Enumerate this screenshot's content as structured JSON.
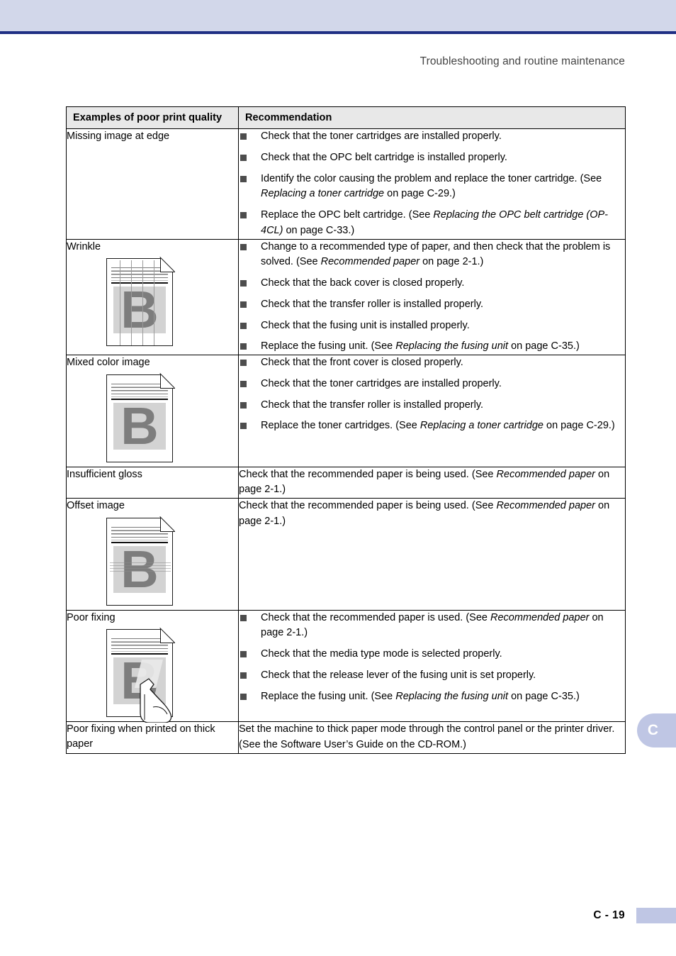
{
  "page": {
    "running_header": "Troubleshooting and routine maintenance",
    "folio": "C - 19",
    "thumb_tab": "C",
    "colors": {
      "band": "#d2d7ea",
      "rule": "#1f2f84",
      "tab": "#bfc6e4",
      "header_row": "#e8e8e8",
      "bullet": "#4d4d4d"
    }
  },
  "table": {
    "headers": {
      "col_a": "Examples of poor print quality",
      "col_b": "Recommendation"
    },
    "rows": [
      {
        "label": "Missing image at edge",
        "illustration": "none",
        "list": [
          "Check that the toner cartridges are installed properly.",
          "Check that the OPC belt cartridge is installed properly.",
          "Identify the color causing the problem and replace the toner cartridge. (See Replacing a toner cartridge on page C-29.)",
          "Replace the OPC belt cartridge. (See Replacing the OPC belt cartridge (OP-4CL) on page C-33.)"
        ],
        "list_html": [
          "Check that the toner cartridges are installed properly.",
          "Check that the OPC belt cartridge is installed properly.",
          "Identify the color causing the problem and replace the toner cartridge. (See <em>Replacing a toner cartridge</em> on page C-29.)",
          "Replace the OPC belt cartridge. (See <em>Replacing the OPC belt cartridge (OP-4CL)</em> on page C-33.)"
        ]
      },
      {
        "label": "Wrinkle",
        "illustration": "wrinkled-page-sample",
        "list": [
          "Change to a recommended type of paper, and then check that the problem is solved. (See Recommended paper on page 2-1.)",
          "Check that the back cover is closed properly.",
          "Check that the transfer roller is installed properly.",
          "Check that the fusing unit is installed properly.",
          "Replace the fusing unit. (See Replacing the fusing unit on page C-35.)"
        ],
        "list_html": [
          "Change to a recommended type of paper, and then check that the problem is solved. (See <em>Recommended paper</em> on page 2-1.)",
          "Check that the back cover is closed properly.",
          "Check that the transfer roller is installed properly.",
          "Check that the fusing unit is installed properly.",
          "Replace the fusing unit. (See <em>Replacing the fusing unit</em> on page C-35.)"
        ]
      },
      {
        "label": "Mixed color image",
        "illustration": "mixed-color-page-sample",
        "list": [
          "Check that the front cover is closed properly.",
          "Check that the toner cartridges are installed properly.",
          "Check that the transfer roller is installed properly.",
          "Replace the toner cartridges. (See Replacing a toner cartridge on page C-29.)"
        ],
        "list_html": [
          "Check that the front cover is closed properly.",
          "Check that the toner cartridges are installed properly.",
          "Check that the transfer roller is installed properly.",
          "Replace the toner cartridges. (See <em>Replacing a toner cartridge</em> on page C-29.)"
        ]
      },
      {
        "label": "Insufficient gloss",
        "illustration": "none",
        "paragraph": "Check that the recommended paper is being used. (See Recommended paper on page 2-1.)",
        "paragraph_html": "Check that the recommended paper is being used. (See <em>Recommended paper</em> on page 2-1.)"
      },
      {
        "label": "Offset image",
        "illustration": "offset-image-page-sample",
        "paragraph": "Check that the recommended paper is being used. (See Recommended paper on page 2-1.)",
        "paragraph_html": "Check that the recommended paper is being used. (See <em>Recommended paper</em> on page 2-1.)"
      },
      {
        "label": "Poor fixing",
        "illustration": "poor-fixing-page-sample",
        "list": [
          "Check that the recommended paper is used. (See Recommended paper on page 2-1.)",
          "Check that the media type mode is selected properly.",
          "Check that the release lever of the fusing unit is set properly.",
          "Replace the fusing unit. (See Replacing the fusing unit on page C-35.)"
        ],
        "list_html": [
          "Check that the recommended paper is used. (See <em>Recommended paper</em> on page 2-1.)",
          "Check that the media type mode is selected properly.",
          "Check that the release lever of the fusing unit is set properly.",
          "Replace the fusing unit. (See <em>Replacing the fusing unit</em> on page C-35.)"
        ]
      },
      {
        "label": "Poor fixing when printed on thick paper",
        "illustration": "none",
        "paragraph": "Set the machine to thick paper mode through the control panel or the printer driver. (See the Software User's Guide on the CD-ROM.)",
        "paragraph_html": "Set the machine to thick paper mode through the control panel or the printer driver. (See the Software User&rsquo;s Guide on the CD-ROM.)"
      }
    ]
  }
}
